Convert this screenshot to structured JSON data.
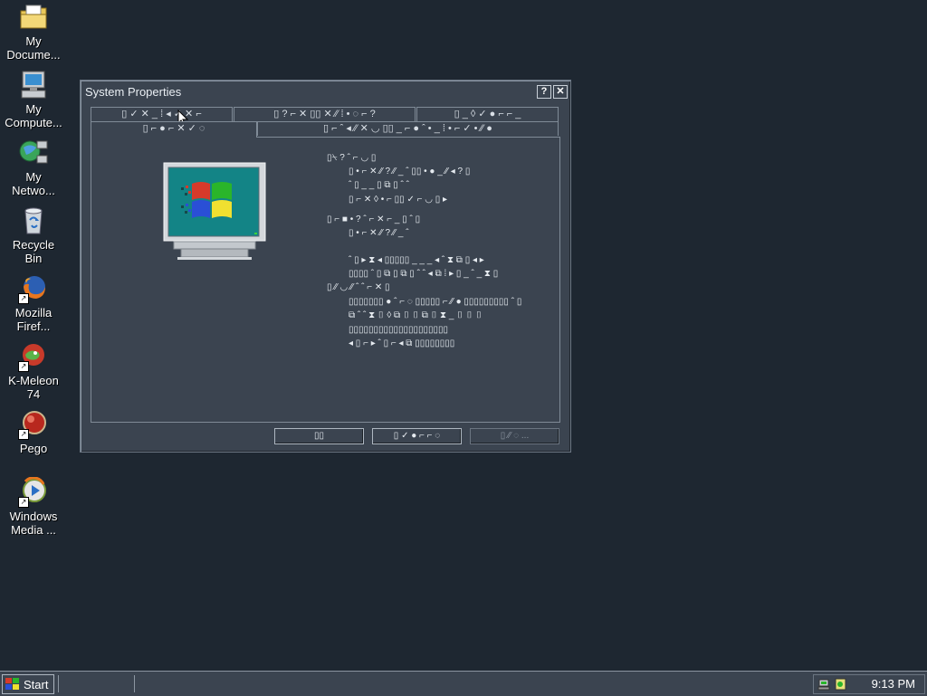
{
  "desktop": {
    "icons": [
      {
        "label_line1": "My",
        "label_line2": "Docume..."
      },
      {
        "label_line1": "My",
        "label_line2": "Compute..."
      },
      {
        "label_line1": "My",
        "label_line2": "Netwo..."
      },
      {
        "label_line1": "Recycle",
        "label_line2": "Bin"
      },
      {
        "label_line1": "Mozilla",
        "label_line2": "Firef..."
      },
      {
        "label_line1": "K-Meleon",
        "label_line2": "74"
      },
      {
        "label_line1": "Pego",
        "label_line2": ""
      },
      {
        "label_line1": "Windows",
        "label_line2": "Media ..."
      }
    ]
  },
  "window": {
    "title": "System Properties",
    "help_label": "?",
    "close_label": "✕",
    "tabs_row1": [
      "▯ ✓ ✕ _ ⁞ ◂ ✓ ✕ ⌐",
      "▯ ? ⌐ ✕ ▯▯ ✕ ⁄⁄ ⁞ • ◌ ⌐ ?",
      "▯ _ ◊ ✓ ● ⌐ ⌐ _"
    ],
    "tabs_row2": [
      "▯ ⌐ ● ⌐ ✕ ✓ ◌",
      "▯ ⌐ ˆ ◂ ⁄⁄ ✕ ◡ ▯▯ _ ⌐ ● ˆ • _ ⁞ • ⌐ ✓ • ⁄⁄ ●"
    ],
    "info_lines": [
      "▯⍀ ? ˆ ⌐ ◡ ▯",
      "▯ • ⌐ ✕ ⁄⁄ ? ⁄⁄ _ ˆ ▯▯ • ● _ ⁄⁄ ◂ ? ▯",
      "ˆ ▯ _ _ ▯ ⧉ ▯ ˆ ˆ",
      "▯ ⌐ ✕ ◊ • ⌐ ▯▯ ✓ ⌐ ◡ ▯ ▸",
      "▯ ⌐ ■ • ? ˆ ⌐ ✕ ⌐ _ ▯ ˆ ▯",
      "▯ • ⌐ ✕ ⁄⁄ ? ⁄⁄ _ ˆ",
      "ˆ ▯ ▸ ⧗ ◂ ▯▯▯▯▯ _ _ _ ◂ ˆ ⧗ ⧉ ▯ ◂ ▸",
      "▯▯▯▯ ˆ ▯ ⧉ ▯ ⧉ ▯ ˆ ˆ ◂ ⧉ ⁞ ▸ ▯ _ ˆ _ ⧗ ▯",
      "▯ ⁄⁄ ◡ ⁄⁄ ˆ ˆ ⌐ ✕ ▯",
      "▯▯▯▯▯▯▯ ● ˆ ⌐ ◌ ▯▯▯▯▯ ⌐ ⁄⁄ ● ▯▯▯▯▯▯▯▯▯ ˆ ▯",
      "⧉ ˆ ˆ ⧗ ▯ ◊ ⧉ ▯ ▯ ⧉ ▯ ⧗ _ ▯ ▯ ▯",
      "▯▯▯▯▯▯▯▯▯▯▯▯▯▯▯▯▯▯▯▯",
      "◂ ▯ ⌐ ▸ ˆ ▯ ⌐ ◂ ⧉ ▯▯▯▯▯▯▯▯"
    ],
    "buttons": {
      "ok": "▯▯",
      "cancel": "▯ ✓ ● ⌐ ⌐ ◌",
      "apply": "▯ ⁄⁄ ◌ ..."
    }
  },
  "taskbar": {
    "start_label": "Start",
    "clock": "9:13 PM"
  }
}
